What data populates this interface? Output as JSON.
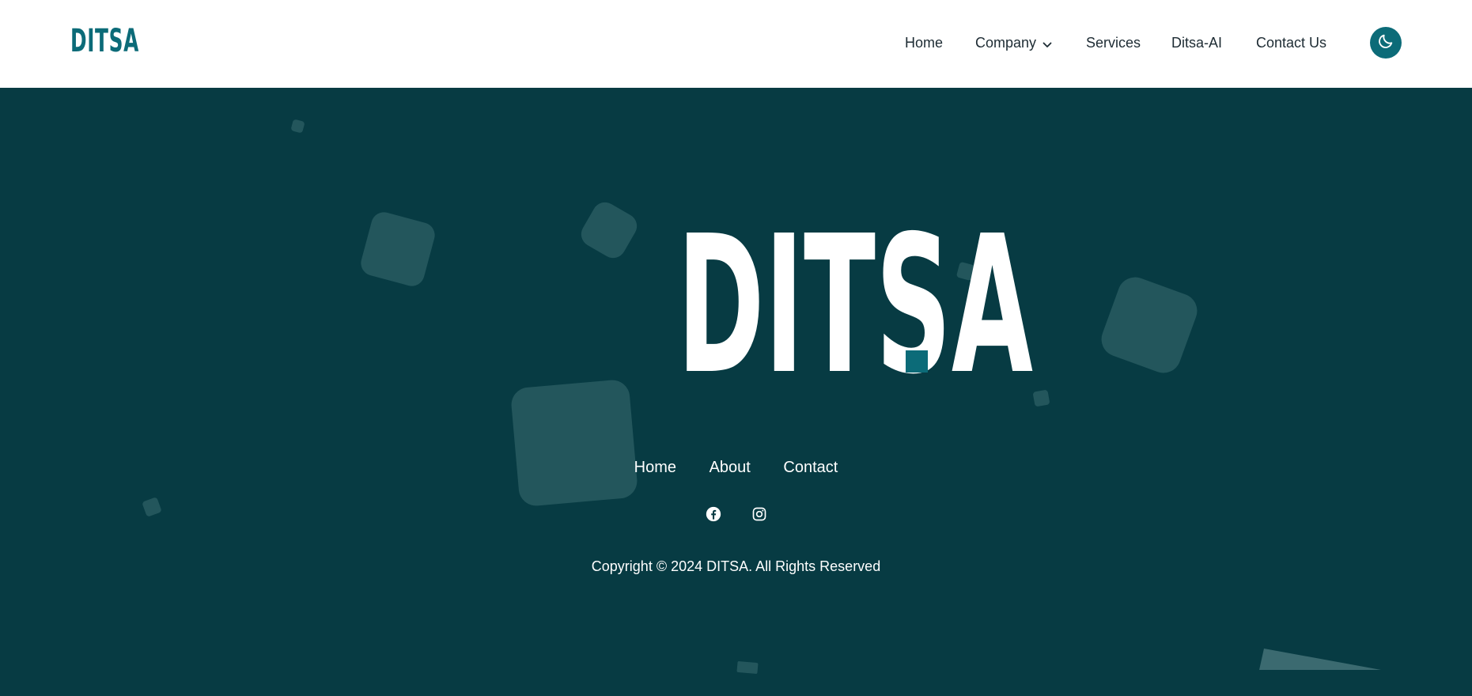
{
  "header": {
    "logo_text": "DITSA",
    "nav": [
      {
        "label": "Home"
      },
      {
        "label": "Company",
        "has_dropdown": true
      },
      {
        "label": "Services"
      },
      {
        "label": "Ditsa-AI"
      },
      {
        "label": "Contact Us"
      }
    ],
    "theme_toggle_icon": "moon-icon"
  },
  "footer": {
    "brand": "DITSA",
    "brand_dot": ".",
    "links": [
      {
        "label": "Home"
      },
      {
        "label": "About"
      },
      {
        "label": "Contact"
      }
    ],
    "social": [
      {
        "icon": "facebook-icon"
      },
      {
        "icon": "instagram-icon"
      }
    ],
    "copyright": "Copyright © 2024 DITSA. All Rights Reserved"
  },
  "colors": {
    "accent": "#0c6b78",
    "footer_bg": "#073b43",
    "shape": "#23565c",
    "header_bg": "#ffffff"
  }
}
